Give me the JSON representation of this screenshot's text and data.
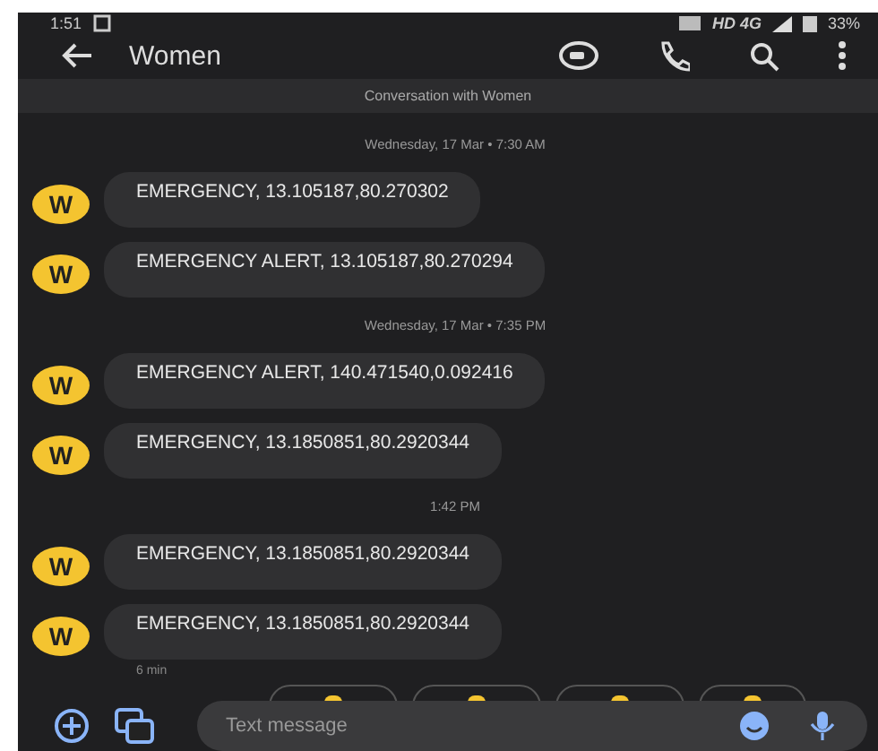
{
  "status_bar": {
    "time": "1:51",
    "network": "HD 4G",
    "battery": "33%"
  },
  "app_bar": {
    "title": "Women"
  },
  "banner": "Conversation with Women",
  "thread": [
    {
      "kind": "date",
      "text": "Wednesday, 17 Mar • 7:30 AM"
    },
    {
      "kind": "message",
      "avatar": "W",
      "text": "EMERGENCY, 13.105187,80.270302"
    },
    {
      "kind": "message",
      "avatar": "W",
      "text": "EMERGENCY ALERT, 13.105187,80.270294"
    },
    {
      "kind": "date",
      "text": "Wednesday, 17 Mar • 7:35 PM"
    },
    {
      "kind": "message",
      "avatar": "W",
      "text": "EMERGENCY ALERT, 140.471540,0.092416"
    },
    {
      "kind": "message",
      "avatar": "W",
      "text": "EMERGENCY, 13.1850851,80.2920344"
    },
    {
      "kind": "date",
      "text": "1:42 PM"
    },
    {
      "kind": "message",
      "avatar": "W",
      "text": "EMERGENCY, 13.1850851,80.2920344"
    },
    {
      "kind": "message",
      "avatar": "W",
      "text": "EMERGENCY, 13.1850851,80.2920344",
      "meta": "6 min"
    }
  ],
  "composer": {
    "placeholder": "Text message"
  }
}
